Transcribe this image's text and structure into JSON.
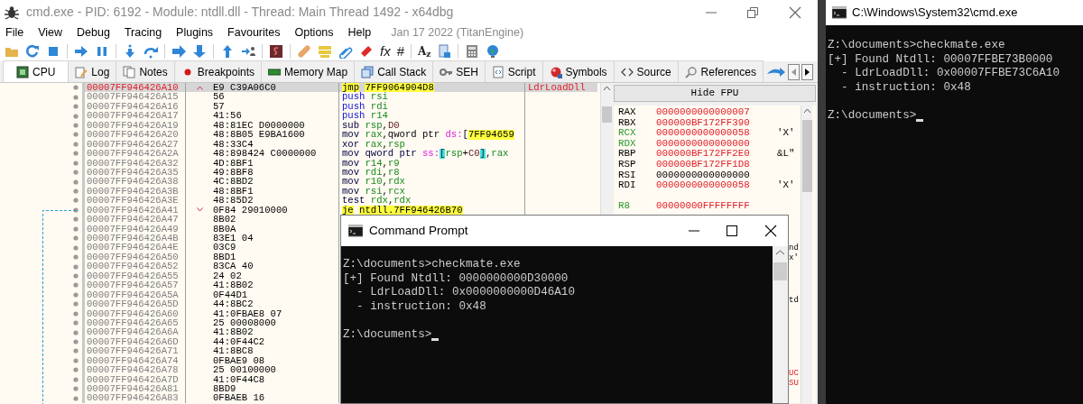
{
  "debugger_window": {
    "title": "cmd.exe - PID: 6192 - Module: ntdll.dll - Thread: Main Thread 1492 - x64dbg",
    "menu": [
      "File",
      "View",
      "Debug",
      "Tracing",
      "Plugins",
      "Favourites",
      "Options",
      "Help"
    ],
    "build_info": "Jan 17 2022 (TitanEngine)",
    "toolbar_glyphs": [
      "fx",
      "#",
      "A$_{z}$"
    ],
    "tabs": [
      {
        "label": "CPU",
        "selected": true
      },
      {
        "label": "Log",
        "selected": false
      },
      {
        "label": "Notes",
        "selected": false
      },
      {
        "label": "Breakpoints",
        "selected": false
      },
      {
        "label": "Memory Map",
        "selected": false
      },
      {
        "label": "Call Stack",
        "selected": false
      },
      {
        "label": "SEH",
        "selected": false
      },
      {
        "label": "Script",
        "selected": false
      },
      {
        "label": "Symbols",
        "selected": false
      },
      {
        "label": "Source",
        "selected": false
      },
      {
        "label": "References",
        "selected": false
      }
    ],
    "disassembly": {
      "rows": [
        {
          "address": "00007FF946426A10",
          "bytes": "E9 C39A06C0",
          "selected": true,
          "jump_up": true,
          "instruction": [
            {
              "text": "jmp",
              "kind": "jmp"
            },
            {
              "text": "7FF9064904D8",
              "kind": "addr"
            }
          ],
          "comment": "LdrLoadDll"
        },
        {
          "address": "00007FF946426A15",
          "bytes": "56",
          "selected": false,
          "instruction": [
            {
              "text": "push ",
              "kind": "push"
            },
            {
              "text": "rsi",
              "kind": "reg"
            }
          ]
        },
        {
          "address": "00007FF946426A16",
          "bytes": "57",
          "selected": false,
          "instruction": [
            {
              "text": "push ",
              "kind": "push"
            },
            {
              "text": "rdi",
              "kind": "reg"
            }
          ]
        },
        {
          "address": "00007FF946426A17",
          "bytes": "41:56",
          "selected": false,
          "instruction": [
            {
              "text": "push ",
              "kind": "push"
            },
            {
              "text": "r14",
              "kind": "reg"
            }
          ]
        },
        {
          "address": "00007FF946426A19",
          "bytes": "48:81EC D0000000",
          "selected": false,
          "instruction": [
            {
              "text": "sub ",
              "kind": "mnem"
            },
            {
              "text": "rsp",
              "kind": "reg"
            },
            {
              "text": ",",
              "kind": "plain"
            },
            {
              "text": "D0",
              "kind": "num"
            }
          ]
        },
        {
          "address": "00007FF946426A20",
          "bytes": "48:8B05 E9BA1600",
          "selected": false,
          "instruction": [
            {
              "text": "mov ",
              "kind": "mnem"
            },
            {
              "text": "rax",
              "kind": "reg"
            },
            {
              "text": ",qword ptr ",
              "kind": "plain"
            },
            {
              "text": "ds:",
              "kind": "seg"
            },
            {
              "text": "[",
              "kind": "plain"
            },
            {
              "text": "7FF94659",
              "kind": "addr"
            }
          ]
        },
        {
          "address": "00007FF946426A27",
          "bytes": "48:33C4",
          "selected": false,
          "instruction": [
            {
              "text": "xor ",
              "kind": "mnem"
            },
            {
              "text": "rax",
              "kind": "reg"
            },
            {
              "text": ",",
              "kind": "plain"
            },
            {
              "text": "rsp",
              "kind": "reg"
            }
          ]
        },
        {
          "address": "00007FF946426A2A",
          "bytes": "48:898424 C0000000",
          "selected": false,
          "instruction": [
            {
              "text": "mov qword ptr ",
              "kind": "mnem"
            },
            {
              "text": "ss:",
              "kind": "seg"
            },
            {
              "text": "[",
              "kind": "brk"
            },
            {
              "text": "rsp",
              "kind": "reg"
            },
            {
              "text": "+",
              "kind": "plain"
            },
            {
              "text": "C0",
              "kind": "num"
            },
            {
              "text": "]",
              "kind": "brk"
            },
            {
              "text": ",",
              "kind": "plain"
            },
            {
              "text": "rax",
              "kind": "reg"
            }
          ]
        },
        {
          "address": "00007FF946426A32",
          "bytes": "4D:8BF1",
          "selected": false,
          "instruction": [
            {
              "text": "mov ",
              "kind": "mnem"
            },
            {
              "text": "r14",
              "kind": "reg"
            },
            {
              "text": ",",
              "kind": "plain"
            },
            {
              "text": "r9",
              "kind": "reg"
            }
          ]
        },
        {
          "address": "00007FF946426A35",
          "bytes": "49:8BF8",
          "selected": false,
          "instruction": [
            {
              "text": "mov ",
              "kind": "mnem"
            },
            {
              "text": "rdi",
              "kind": "reg"
            },
            {
              "text": ",",
              "kind": "plain"
            },
            {
              "text": "r8",
              "kind": "reg"
            }
          ]
        },
        {
          "address": "00007FF946426A38",
          "bytes": "4C:8BD2",
          "selected": false,
          "instruction": [
            {
              "text": "mov ",
              "kind": "mnem"
            },
            {
              "text": "r10",
              "kind": "reg"
            },
            {
              "text": ",",
              "kind": "plain"
            },
            {
              "text": "rdx",
              "kind": "reg"
            }
          ]
        },
        {
          "address": "00007FF946426A3B",
          "bytes": "48:8BF1",
          "selected": false,
          "instruction": [
            {
              "text": "mov ",
              "kind": "mnem"
            },
            {
              "text": "rsi",
              "kind": "reg"
            },
            {
              "text": ",",
              "kind": "plain"
            },
            {
              "text": "rcx",
              "kind": "reg"
            }
          ]
        },
        {
          "address": "00007FF946426A3E",
          "bytes": "48:85D2",
          "selected": false,
          "instruction": [
            {
              "text": "test ",
              "kind": "mnem"
            },
            {
              "text": "rdx",
              "kind": "reg"
            },
            {
              "text": ",",
              "kind": "plain"
            },
            {
              "text": "rdx",
              "kind": "reg"
            }
          ]
        },
        {
          "address": "00007FF946426A41",
          "bytes": "0F84 29010000",
          "selected": false,
          "jump_down": true,
          "instruction": [
            {
              "text": "je",
              "kind": "jmp"
            },
            {
              "text": "ntdll.7FF946426B70",
              "kind": "addr"
            }
          ]
        },
        {
          "address": "00007FF946426A47",
          "bytes": "8B02",
          "selected": false
        },
        {
          "address": "00007FF946426A49",
          "bytes": "8B0A",
          "selected": false
        },
        {
          "address": "00007FF946426A4B",
          "bytes": "83E1 04",
          "selected": false
        },
        {
          "address": "00007FF946426A4E",
          "bytes": "03C9",
          "selected": false
        },
        {
          "address": "00007FF946426A50",
          "bytes": "8BD1",
          "selected": false
        },
        {
          "address": "00007FF946426A52",
          "bytes": "83CA 40",
          "selected": false
        },
        {
          "address": "00007FF946426A55",
          "bytes": "24 02",
          "selected": false
        },
        {
          "address": "00007FF946426A57",
          "bytes": "41:8B02",
          "selected": false
        },
        {
          "address": "00007FF946426A5A",
          "bytes": "0F44D1",
          "selected": false
        },
        {
          "address": "00007FF946426A5D",
          "bytes": "44:8BC2",
          "selected": false
        },
        {
          "address": "00007FF946426A60",
          "bytes": "41:0FBAE8 07",
          "selected": false
        },
        {
          "address": "00007FF946426A65",
          "bytes": "25 00008000",
          "selected": false
        },
        {
          "address": "00007FF946426A6A",
          "bytes": "41:8B02",
          "selected": false
        },
        {
          "address": "00007FF946426A6D",
          "bytes": "44:0F44C2",
          "selected": false
        },
        {
          "address": "00007FF946426A71",
          "bytes": "41:8BC8",
          "selected": false
        },
        {
          "address": "00007FF946426A74",
          "bytes": "0FBAE9 08",
          "selected": false
        },
        {
          "address": "00007FF946426A78",
          "bytes": "25 00100000",
          "selected": false
        },
        {
          "address": "00007FF946426A7D",
          "bytes": "41:0F44C8",
          "selected": false
        },
        {
          "address": "00007FF946426A81",
          "bytes": "8BD9",
          "selected": false
        },
        {
          "address": "00007FF946426A83",
          "bytes": "0FBAEB 16",
          "selected": false
        }
      ]
    },
    "fpu_button": "Hide FPU",
    "registers": [
      {
        "kind": "register",
        "name": "RAX",
        "value": "0000000000000007",
        "value_modified": true,
        "name_highlighted": false
      },
      {
        "kind": "register",
        "name": "RBX",
        "value": "000000BF172FF390",
        "value_modified": true,
        "name_highlighted": false
      },
      {
        "kind": "register",
        "name": "RCX",
        "value": "0000000000000058",
        "value_modified": true,
        "name_highlighted": true,
        "comment": "'X'"
      },
      {
        "kind": "register",
        "name": "RDX",
        "value": "0000000000000000",
        "value_modified": true,
        "name_highlighted": true
      },
      {
        "kind": "register",
        "name": "RBP",
        "value": "000000BF172FF2E0",
        "value_modified": true,
        "name_highlighted": false,
        "comment": "&L\""
      },
      {
        "kind": "register",
        "name": "RSP",
        "value": "000000BF172FF1D8",
        "value_modified": true,
        "name_highlighted": false
      },
      {
        "kind": "register",
        "name": "RSI",
        "value": "0000000000000000",
        "value_modified": false,
        "name_highlighted": false
      },
      {
        "kind": "register",
        "name": "RDI",
        "value": "0000000000000058",
        "value_modified": true,
        "name_highlighted": false,
        "comment": "'X'"
      },
      {
        "kind": "gap"
      },
      {
        "kind": "register",
        "name": "R8",
        "value": "00000000FFFFFFFF",
        "value_modified": true,
        "name_highlighted": true
      },
      {
        "kind": "gap"
      },
      {
        "kind": "gap"
      },
      {
        "kind": "gap"
      },
      {
        "kind": "fragment",
        "comment": "nd",
        "modified": false
      },
      {
        "kind": "fragment",
        "comment": "x'",
        "modified": false
      },
      {
        "kind": "gap"
      },
      {
        "kind": "gap"
      },
      {
        "kind": "gap"
      },
      {
        "kind": "fragment",
        "comment": "td",
        "modified": false
      },
      {
        "kind": "gap"
      },
      {
        "kind": "gap"
      },
      {
        "kind": "gap"
      },
      {
        "kind": "gap"
      },
      {
        "kind": "gap"
      },
      {
        "kind": "gap"
      },
      {
        "kind": "fragment",
        "comment": "UC",
        "modified": true
      },
      {
        "kind": "fragment",
        "comment": "SU",
        "modified": true
      }
    ]
  },
  "command_prompt": {
    "title": "Command Prompt",
    "lines": [
      "Z:\\documents>checkmate.exe",
      "[+] Found Ntdll: 0000000000D30000",
      "  - LdrLoadDll: 0x0000000000D46A10",
      "  - instruction: 0x48"
    ],
    "prompt": "Z:\\documents>",
    "cursor_visible": true
  },
  "console_window": {
    "title": "C:\\Windows\\System32\\cmd.exe",
    "lines": [
      "Z:\\documents>checkmate.exe",
      "[+] Found Ntdll: 00007FFBE73B0000",
      "  - LdrLoadDll: 0x00007FFBE73C6A10",
      "  - instruction: 0x48"
    ],
    "prompt": "Z:\\documents>",
    "cursor_visible": true
  }
}
